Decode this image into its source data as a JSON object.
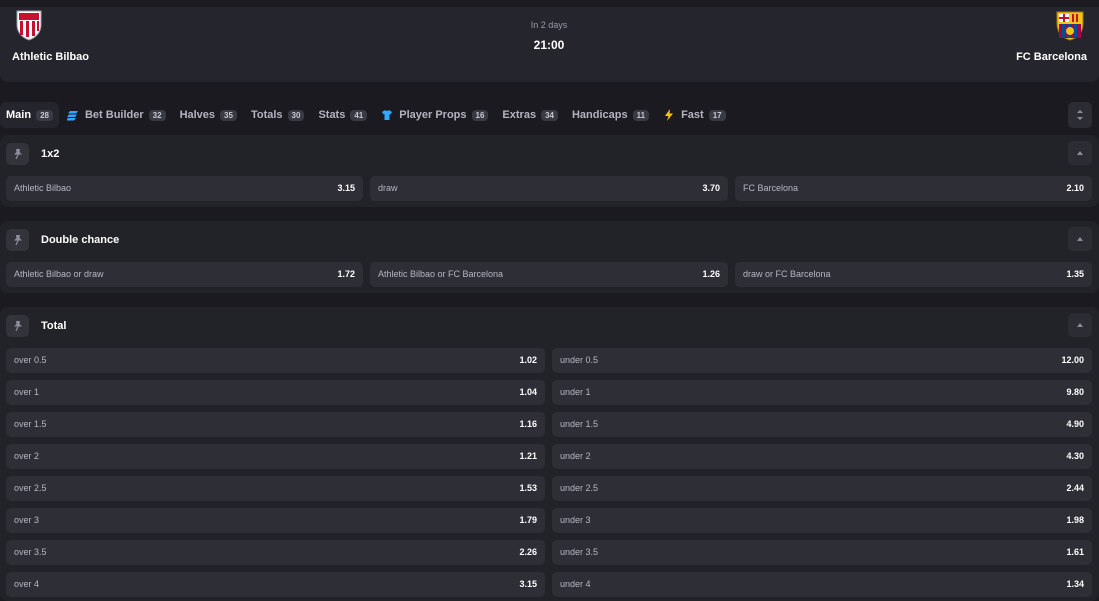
{
  "match": {
    "home_team": "Athletic Bilbao",
    "away_team": "FC Barcelona",
    "when": "In 2 days",
    "time": "21:00"
  },
  "tabs": [
    {
      "label": "Main",
      "count": "28",
      "active": true
    },
    {
      "label": "Bet Builder",
      "count": "32",
      "icon": "bet-builder-icon"
    },
    {
      "label": "Halves",
      "count": "35"
    },
    {
      "label": "Totals",
      "count": "30"
    },
    {
      "label": "Stats",
      "count": "41"
    },
    {
      "label": "Player Props",
      "count": "16",
      "icon": "jersey-icon"
    },
    {
      "label": "Extras",
      "count": "34"
    },
    {
      "label": "Handicaps",
      "count": "11"
    },
    {
      "label": "Fast",
      "count": "17",
      "icon": "lightning-icon"
    }
  ],
  "markets": {
    "one_x_two": {
      "title": "1x2",
      "outcomes": [
        {
          "label": "Athletic Bilbao",
          "price": "3.15"
        },
        {
          "label": "draw",
          "price": "3.70"
        },
        {
          "label": "FC Barcelona",
          "price": "2.10"
        }
      ]
    },
    "double_chance": {
      "title": "Double chance",
      "outcomes": [
        {
          "label": "Athletic Bilbao or draw",
          "price": "1.72"
        },
        {
          "label": "Athletic Bilbao or FC Barcelona",
          "price": "1.26"
        },
        {
          "label": "draw or FC Barcelona",
          "price": "1.35"
        }
      ]
    },
    "total": {
      "title": "Total",
      "rows": [
        {
          "over_label": "over 0.5",
          "over_price": "1.02",
          "under_label": "under 0.5",
          "under_price": "12.00"
        },
        {
          "over_label": "over 1",
          "over_price": "1.04",
          "under_label": "under 1",
          "under_price": "9.80"
        },
        {
          "over_label": "over 1.5",
          "over_price": "1.16",
          "under_label": "under 1.5",
          "under_price": "4.90"
        },
        {
          "over_label": "over 2",
          "over_price": "1.21",
          "under_label": "under 2",
          "under_price": "4.30"
        },
        {
          "over_label": "over 2.5",
          "over_price": "1.53",
          "under_label": "under 2.5",
          "under_price": "2.44"
        },
        {
          "over_label": "over 3",
          "over_price": "1.79",
          "under_label": "under 3",
          "under_price": "1.98"
        },
        {
          "over_label": "over 3.5",
          "over_price": "2.26",
          "under_label": "under 3.5",
          "under_price": "1.61"
        },
        {
          "over_label": "over 4",
          "over_price": "3.15",
          "under_label": "under 4",
          "under_price": "1.34"
        }
      ]
    }
  },
  "colors": {
    "background": "#1a1a20",
    "panel": "#222229",
    "odd_cell": "#2e2e37",
    "accent_blue": "#2fa8ff",
    "accent_yellow": "#f5c518"
  }
}
